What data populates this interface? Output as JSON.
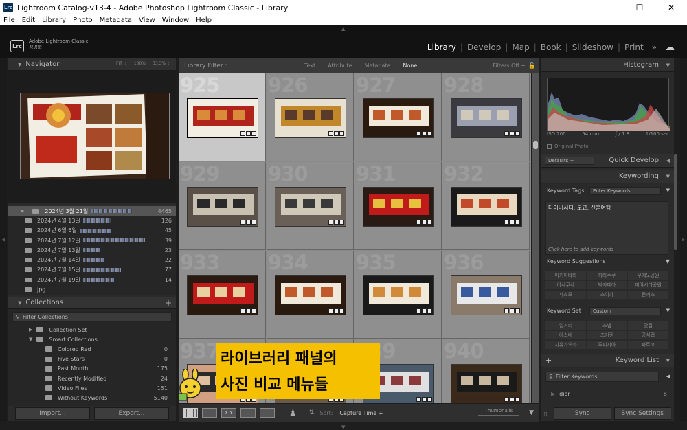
{
  "window": {
    "title": "Lightroom Catalog-v13-4 - Adobe Photoshop Lightroom Classic - Library",
    "app_icon": "Lrc",
    "min": "—",
    "max": "☐",
    "close": "✕"
  },
  "menu": [
    "File",
    "Edit",
    "Library",
    "Photo",
    "Metadata",
    "View",
    "Window",
    "Help"
  ],
  "identity": {
    "logo": "Lrc",
    "product": "Adobe Lightroom Classic",
    "user": "성경화"
  },
  "modules": {
    "items": [
      "Library",
      "Develop",
      "Map",
      "Book",
      "Slideshow",
      "Print"
    ],
    "active": "Library",
    "more": "»",
    "cloud": "☁"
  },
  "navigator": {
    "title": "Navigator",
    "zoom": [
      "FIT ÷",
      "100%",
      "33.3% ÷"
    ]
  },
  "folders": [
    {
      "label": "2024년 3월 21일",
      "count": "4465",
      "selected": true
    },
    {
      "label": "2024년 4월 13일",
      "count": "126"
    },
    {
      "label": "2024년 6월 6일",
      "count": "45"
    },
    {
      "label": "2024년 7월 12일",
      "count": "39"
    },
    {
      "label": "2024년 7월 13일",
      "count": "23"
    },
    {
      "label": "2024년 7월 14일",
      "count": "22"
    },
    {
      "label": "2024년 7월 15일",
      "count": "77"
    },
    {
      "label": "2024년 7월 19일",
      "count": "14"
    },
    {
      "label": "jpg",
      "count": ""
    }
  ],
  "collections": {
    "title": "Collections",
    "plus": "+",
    "filter": "Filter Collections",
    "rows": [
      {
        "label": "Collection Set",
        "count": ""
      },
      {
        "label": "Smart Collections",
        "count": ""
      },
      {
        "label": "Colored Red",
        "count": "0"
      },
      {
        "label": "Five Stars",
        "count": "0"
      },
      {
        "label": "Past Month",
        "count": "175"
      },
      {
        "label": "Recently Modified",
        "count": "24"
      },
      {
        "label": "Video Files",
        "count": "151"
      },
      {
        "label": "Without Keywords",
        "count": "5140"
      }
    ]
  },
  "left_buttons": {
    "import": "Import...",
    "export": "Export..."
  },
  "filterbar": {
    "label": "Library Filter :",
    "options": [
      "Text",
      "Attribute",
      "Metadata",
      "None"
    ],
    "active": "None",
    "status": "Filters Off ÷"
  },
  "grid": {
    "cells": [
      "925",
      "926",
      "927",
      "928",
      "929",
      "930",
      "931",
      "932",
      "933",
      "934",
      "935",
      "936",
      "937",
      "938",
      "939",
      "940"
    ],
    "selected": "925"
  },
  "overlay": {
    "line1": "라이브러리 패널의",
    "line2": "사진 비교 메뉴들"
  },
  "toolbar": {
    "sort_label": "Sort:",
    "sort_value": "Capture Time ÷",
    "thumbs": "Thumbnails",
    "xy": "X|Y"
  },
  "right": {
    "histogram": "Histogram",
    "hist_info": [
      "ISO 200",
      "54 mm",
      "ƒ / 1.8",
      "1/100 sec"
    ],
    "original_photo": "Original Photo",
    "quick_develop": "Quick Develop",
    "defaults": "Defaults ÷",
    "keywording": "Keywording",
    "keyword_tags_label": "Keyword Tags",
    "keyword_tags_value": "Enter Keywords",
    "keywords_text": "다이버시티, 도쿄, 신혼여행",
    "add_hint": "Click here to add keywords",
    "suggestions_label": "Keyword Suggestions",
    "suggestions": [
      "아키하바라",
      "하라주쿠",
      "우에노공원",
      "아사쿠사",
      "빅카메라",
      "미야시타공원",
      "파스모",
      "스이카",
      "돈키스"
    ],
    "set_label": "Keyword Set",
    "set_value": "Custom",
    "set_items": [
      "일거리",
      "스냅",
      "맛집",
      "야스베",
      "즈커렌",
      "공식컵",
      "지유가오카",
      "루피시아",
      "파르코"
    ],
    "keyword_list": "Keyword List",
    "filter_keywords": "Filter Keywords",
    "list_first": "dior",
    "list_first_count": "8"
  },
  "right_buttons": {
    "sync": "Sync",
    "sync_settings": "Sync Settings"
  },
  "colors": {
    "overlay": "#f4c000",
    "selected_cell": "#c8c8c8",
    "grid_bg": "#8f8f8f"
  }
}
